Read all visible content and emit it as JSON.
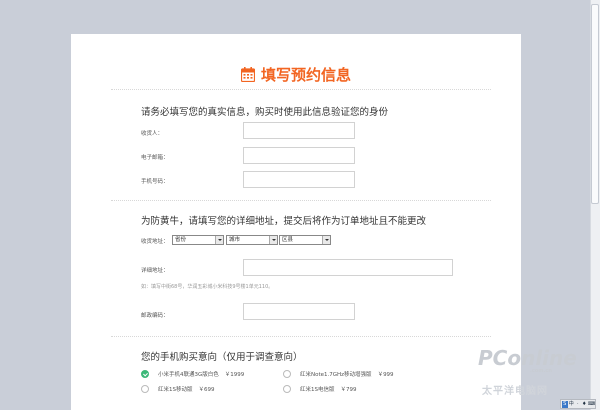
{
  "title": "填写预约信息",
  "identity": {
    "heading": "请务必填写您的真实信息，购买时使用此信息验证您的身份",
    "fields": [
      {
        "label": "收货人：",
        "value": ""
      },
      {
        "label": "电子邮箱：",
        "value": ""
      },
      {
        "label": "手机号码：",
        "value": ""
      }
    ]
  },
  "address": {
    "heading": "为防黄牛，请填写您的详细地址，提交后将作为订单地址且不能更改",
    "region_label": "收货地址：",
    "province": "省份",
    "city": "城市",
    "district": "区县",
    "detail_label": "详细地址：",
    "detail_value": "",
    "hint": "如：填写中街68号，华润五彩城小米科技9号楼1单元110。",
    "zip_label": "邮政编码：",
    "zip_value": ""
  },
  "intent": {
    "heading": "您的手机购买意向（仅用于调查意向）",
    "options": [
      {
        "name": "小米手机4联通3G版白色",
        "price": "￥1999"
      },
      {
        "name": "红米Note1.7GHz移动增强版",
        "price": "￥999"
      },
      {
        "name": "红米1S移动版",
        "price": "￥699"
      },
      {
        "name": "红米1S电信版",
        "price": "￥799"
      }
    ]
  },
  "watermark": {
    "brand": "PConline",
    "sub": ".com.cn",
    "cn": "太平洋电脑网"
  },
  "ime": [
    "S",
    "中",
    "·",
    "♦",
    "⌨"
  ],
  "colors": {
    "accent": "#f26522",
    "check": "#3cb878"
  }
}
